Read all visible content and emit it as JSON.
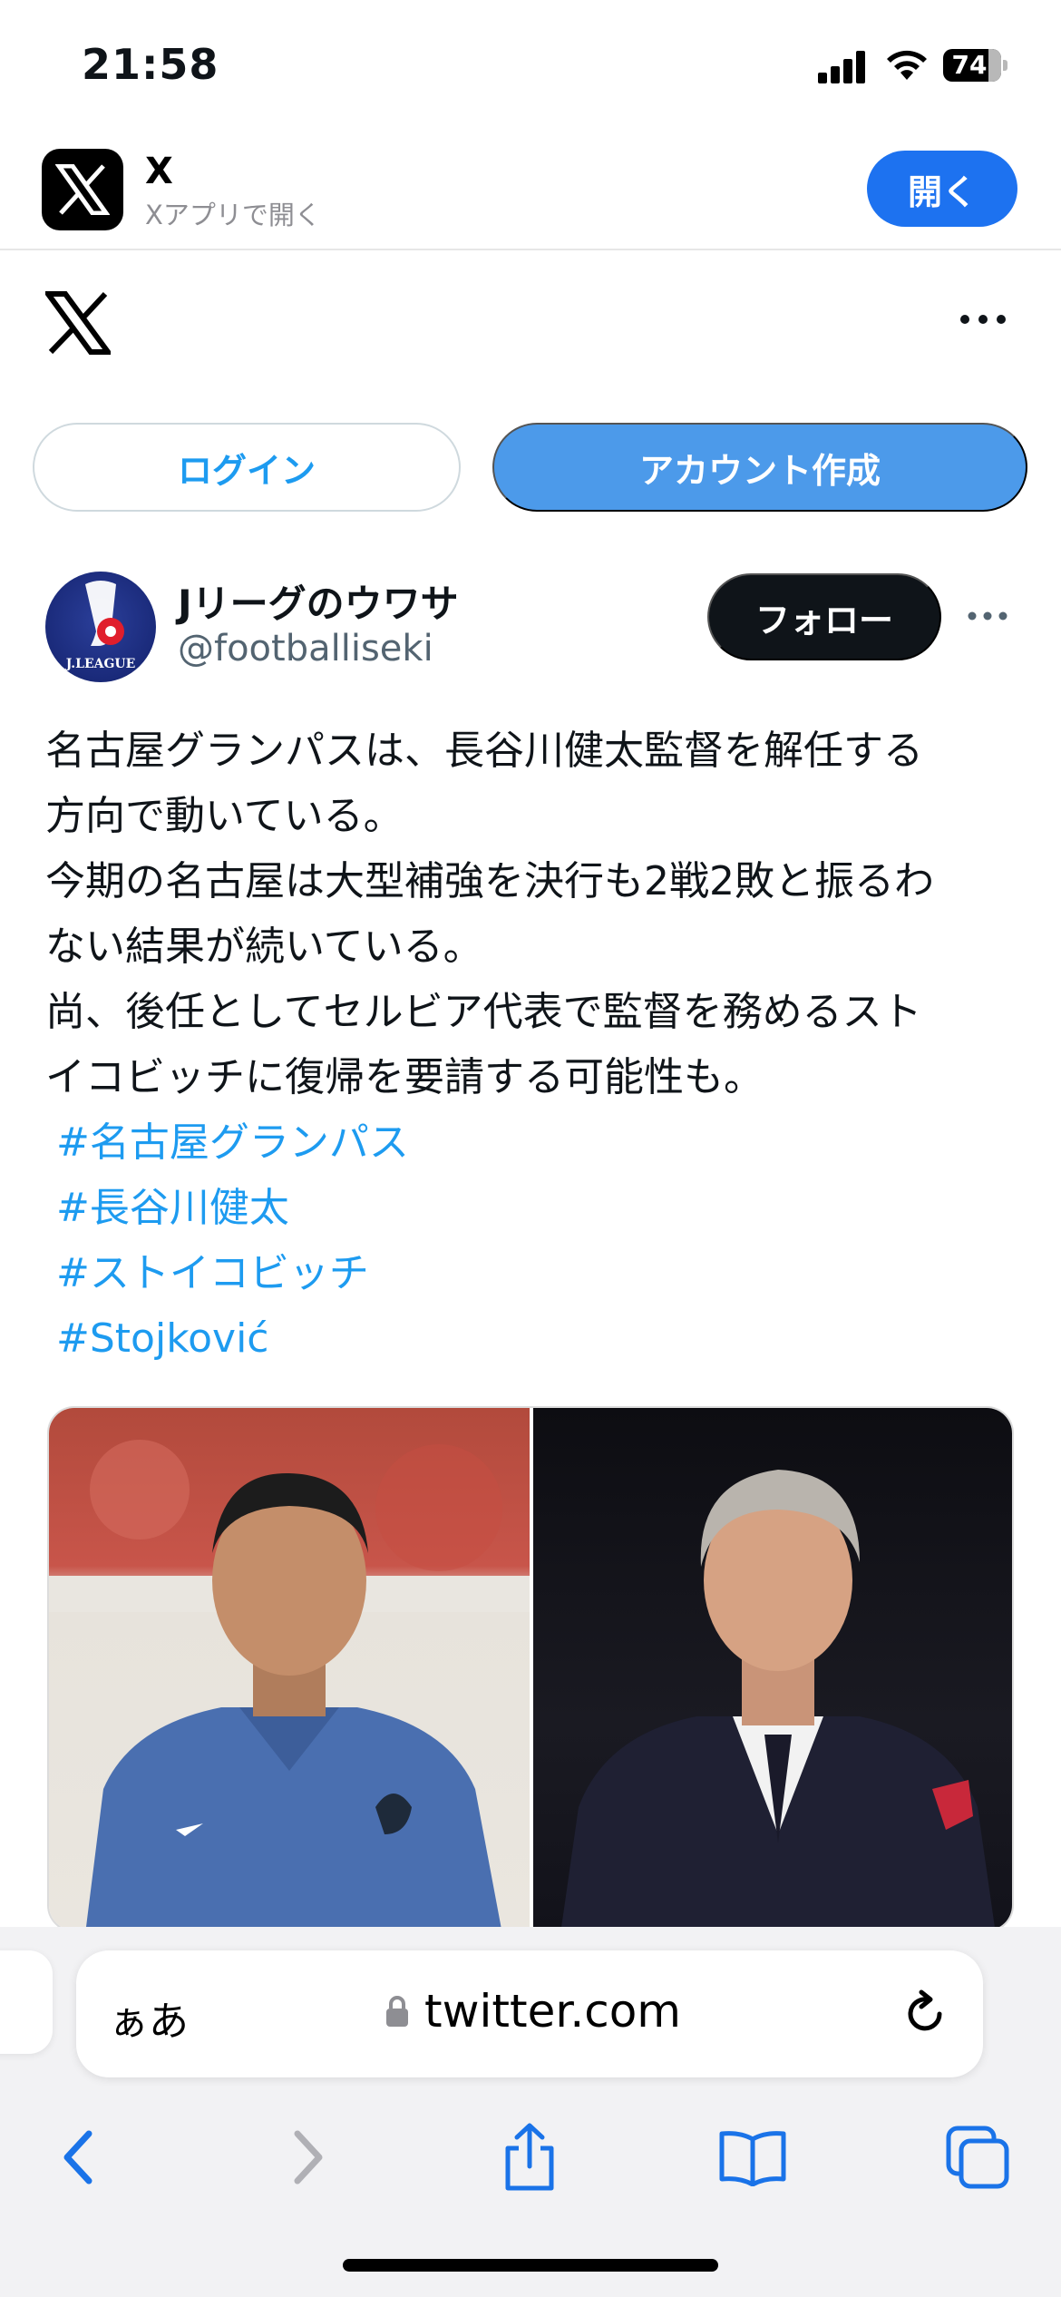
{
  "status_bar": {
    "time": "21:58",
    "battery": "74"
  },
  "app_banner": {
    "name": "X",
    "subtitle": "Xアプリで開く",
    "open_label": "開く"
  },
  "auth": {
    "login_label": "ログイン",
    "signup_label": "アカウント作成"
  },
  "tweet": {
    "author_name": "Jリーグのウワサ",
    "author_handle": "@footballiseki",
    "avatar_text": "J.LEAGUE",
    "follow_label": "フォロー",
    "text_lines": [
      "名古屋グランパスは、長谷川健太監督を解任する",
      "方向で動いている。",
      "今期の名古屋は大型補強を決行も2戦2敗と振るわ",
      "ない結果が続いている。",
      "尚、後任としてセルビア代表で監督を務めるスト",
      "イコビッチに復帰を要請する可能性も。"
    ],
    "hashtags": [
      "#名古屋グランパス",
      "#長谷川健太",
      "#ストイコビッチ",
      "#Stojković"
    ]
  },
  "browser": {
    "aa_label": "ぁあ",
    "url": "twitter.com"
  },
  "colors": {
    "accent": "#1d9bf0",
    "open_button": "#1d72f0",
    "signup_button": "#4c9aea",
    "follow_button": "#0f1419"
  }
}
